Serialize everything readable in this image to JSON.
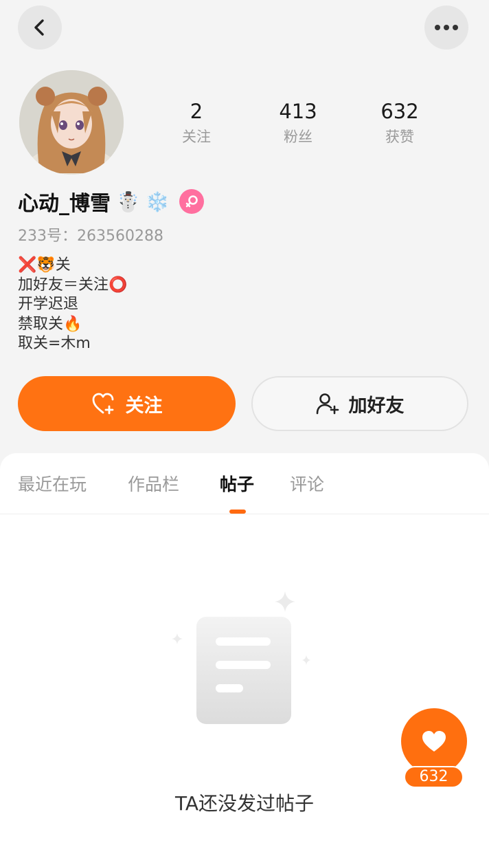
{
  "header": {
    "back_icon": "chevron-left-icon",
    "more_icon": "more-dots-icon"
  },
  "profile": {
    "avatar": "anime-girl-avatar",
    "username": "心动_博雪",
    "username_emoji": "☃️",
    "badge_emoji": "❄️",
    "gender_icon": "female-icon",
    "uid_label": "233号：",
    "uid_value": "263560288",
    "stats": [
      {
        "value": "2",
        "label": "关注"
      },
      {
        "value": "413",
        "label": "粉丝"
      },
      {
        "value": "632",
        "label": "获赞"
      }
    ],
    "bio": [
      {
        "prefix": "❌🐯",
        "text": "关",
        "suffix": ""
      },
      {
        "prefix": "",
        "text": "加好友＝关注",
        "suffix": "⭕"
      },
      {
        "prefix": "",
        "text": "开学迟退",
        "suffix": ""
      },
      {
        "prefix": "",
        "text": "禁取关",
        "suffix": "🔥"
      },
      {
        "prefix": "",
        "text": "取关=木m",
        "suffix": ""
      }
    ]
  },
  "actions": {
    "follow_label": "关注",
    "add_friend_label": "加好友"
  },
  "tabs": [
    {
      "label": "最近在玩",
      "active": false
    },
    {
      "label": "作品栏",
      "active": false
    },
    {
      "label": "帖子",
      "active": true
    },
    {
      "label": "评论",
      "active": false
    }
  ],
  "empty_state": {
    "icon": "empty-document-icon",
    "text": "TA还没发过帖子"
  },
  "like_fab": {
    "icon": "heart-icon",
    "count": "632"
  },
  "colors": {
    "accent": "#ff7212",
    "background": "#f4f4f4",
    "gender": "#ff6f9f"
  }
}
